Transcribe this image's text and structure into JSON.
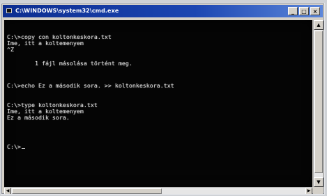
{
  "window": {
    "title": "C:\\WINDOWS\\system32\\cmd.exe",
    "buttons": {
      "minimize": "_",
      "maximize": "□",
      "close": "×"
    }
  },
  "console": {
    "lines": [
      "C:\\>copy con koltonkeskora.txt",
      "Ime, itt a koltemenyem",
      "^Z",
      "        1 fájl másolása történt meg.",
      "",
      "C:\\>echo Ez a második sora. >> koltonkeskora.txt",
      "",
      "C:\\>type koltonkeskora.txt",
      "Ime, itt a koltemenyem",
      "Ez a második sora.",
      "",
      "C:\\>"
    ]
  },
  "scrollbars": {
    "vertical": {
      "up_arrow": "▲",
      "down_arrow": "▼"
    },
    "horizontal": {
      "left_arrow": "◀",
      "right_arrow": "▶"
    }
  }
}
